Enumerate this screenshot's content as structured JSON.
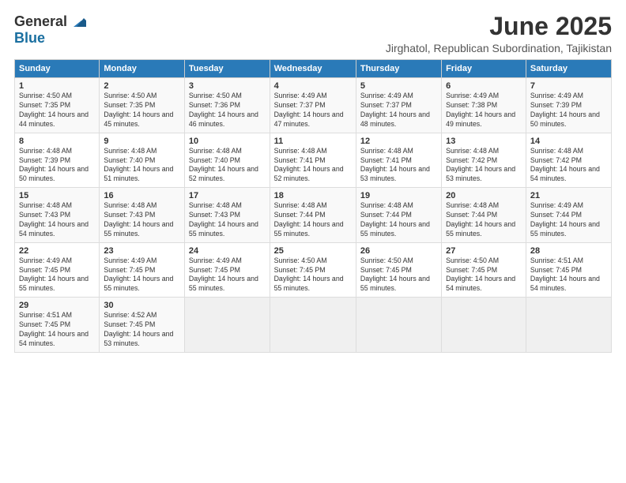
{
  "logo": {
    "general": "General",
    "blue": "Blue"
  },
  "header": {
    "title": "June 2025",
    "subtitle": "Jirghatol, Republican Subordination, Tajikistan"
  },
  "calendar": {
    "days_of_week": [
      "Sunday",
      "Monday",
      "Tuesday",
      "Wednesday",
      "Thursday",
      "Friday",
      "Saturday"
    ],
    "weeks": [
      [
        null,
        {
          "day": 2,
          "sunrise": "4:50 AM",
          "sunset": "7:35 PM",
          "daylight": "14 hours and 45 minutes."
        },
        {
          "day": 3,
          "sunrise": "4:50 AM",
          "sunset": "7:36 PM",
          "daylight": "14 hours and 46 minutes."
        },
        {
          "day": 4,
          "sunrise": "4:49 AM",
          "sunset": "7:37 PM",
          "daylight": "14 hours and 47 minutes."
        },
        {
          "day": 5,
          "sunrise": "4:49 AM",
          "sunset": "7:37 PM",
          "daylight": "14 hours and 48 minutes."
        },
        {
          "day": 6,
          "sunrise": "4:49 AM",
          "sunset": "7:38 PM",
          "daylight": "14 hours and 49 minutes."
        },
        {
          "day": 7,
          "sunrise": "4:49 AM",
          "sunset": "7:39 PM",
          "daylight": "14 hours and 50 minutes."
        }
      ],
      [
        {
          "day": 8,
          "sunrise": "4:48 AM",
          "sunset": "7:39 PM",
          "daylight": "14 hours and 50 minutes."
        },
        {
          "day": 9,
          "sunrise": "4:48 AM",
          "sunset": "7:40 PM",
          "daylight": "14 hours and 51 minutes."
        },
        {
          "day": 10,
          "sunrise": "4:48 AM",
          "sunset": "7:40 PM",
          "daylight": "14 hours and 52 minutes."
        },
        {
          "day": 11,
          "sunrise": "4:48 AM",
          "sunset": "7:41 PM",
          "daylight": "14 hours and 52 minutes."
        },
        {
          "day": 12,
          "sunrise": "4:48 AM",
          "sunset": "7:41 PM",
          "daylight": "14 hours and 53 minutes."
        },
        {
          "day": 13,
          "sunrise": "4:48 AM",
          "sunset": "7:42 PM",
          "daylight": "14 hours and 53 minutes."
        },
        {
          "day": 14,
          "sunrise": "4:48 AM",
          "sunset": "7:42 PM",
          "daylight": "14 hours and 54 minutes."
        }
      ],
      [
        {
          "day": 15,
          "sunrise": "4:48 AM",
          "sunset": "7:43 PM",
          "daylight": "14 hours and 54 minutes."
        },
        {
          "day": 16,
          "sunrise": "4:48 AM",
          "sunset": "7:43 PM",
          "daylight": "14 hours and 55 minutes."
        },
        {
          "day": 17,
          "sunrise": "4:48 AM",
          "sunset": "7:43 PM",
          "daylight": "14 hours and 55 minutes."
        },
        {
          "day": 18,
          "sunrise": "4:48 AM",
          "sunset": "7:44 PM",
          "daylight": "14 hours and 55 minutes."
        },
        {
          "day": 19,
          "sunrise": "4:48 AM",
          "sunset": "7:44 PM",
          "daylight": "14 hours and 55 minutes."
        },
        {
          "day": 20,
          "sunrise": "4:48 AM",
          "sunset": "7:44 PM",
          "daylight": "14 hours and 55 minutes."
        },
        {
          "day": 21,
          "sunrise": "4:49 AM",
          "sunset": "7:44 PM",
          "daylight": "14 hours and 55 minutes."
        }
      ],
      [
        {
          "day": 22,
          "sunrise": "4:49 AM",
          "sunset": "7:45 PM",
          "daylight": "14 hours and 55 minutes."
        },
        {
          "day": 23,
          "sunrise": "4:49 AM",
          "sunset": "7:45 PM",
          "daylight": "14 hours and 55 minutes."
        },
        {
          "day": 24,
          "sunrise": "4:49 AM",
          "sunset": "7:45 PM",
          "daylight": "14 hours and 55 minutes."
        },
        {
          "day": 25,
          "sunrise": "4:50 AM",
          "sunset": "7:45 PM",
          "daylight": "14 hours and 55 minutes."
        },
        {
          "day": 26,
          "sunrise": "4:50 AM",
          "sunset": "7:45 PM",
          "daylight": "14 hours and 55 minutes."
        },
        {
          "day": 27,
          "sunrise": "4:50 AM",
          "sunset": "7:45 PM",
          "daylight": "14 hours and 54 minutes."
        },
        {
          "day": 28,
          "sunrise": "4:51 AM",
          "sunset": "7:45 PM",
          "daylight": "14 hours and 54 minutes."
        }
      ],
      [
        {
          "day": 29,
          "sunrise": "4:51 AM",
          "sunset": "7:45 PM",
          "daylight": "14 hours and 54 minutes."
        },
        {
          "day": 30,
          "sunrise": "4:52 AM",
          "sunset": "7:45 PM",
          "daylight": "14 hours and 53 minutes."
        },
        null,
        null,
        null,
        null,
        null
      ]
    ],
    "week1_day1": {
      "day": 1,
      "sunrise": "4:50 AM",
      "sunset": "7:35 PM",
      "daylight": "14 hours and 44 minutes."
    }
  }
}
